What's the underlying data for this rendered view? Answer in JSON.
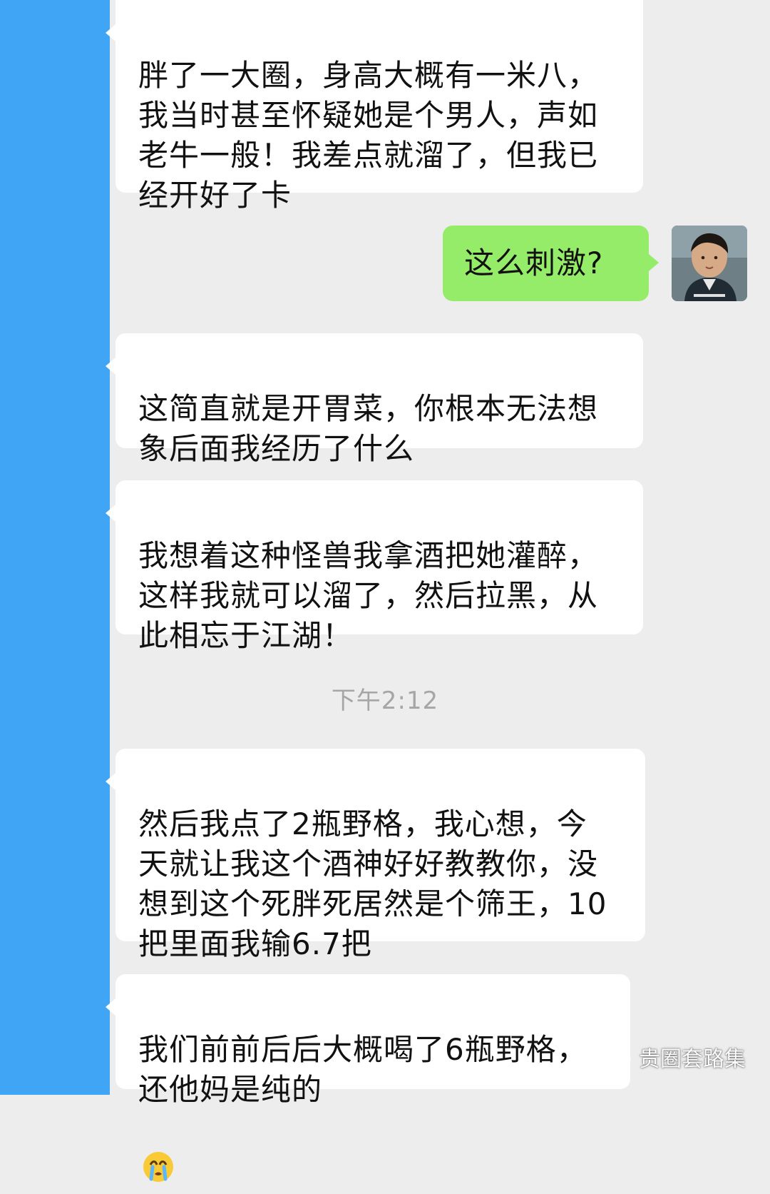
{
  "colors": {
    "left_strip": "#3fa5f4",
    "chat_background": "#ededed",
    "received_bubble": "#ffffff",
    "sent_bubble": "#95ec69",
    "timestamp_text": "#a6a6a6"
  },
  "messages": [
    {
      "side": "received",
      "text": "胖了一大圈，身高大概有一米八，\n我当时甚至怀疑她是个男人，声如\n老牛一般！我差点就溜了，但我已\n经开好了卡"
    },
    {
      "side": "sent",
      "text": "这么刺激?"
    },
    {
      "side": "received",
      "text": "这简直就是开胃菜，你根本无法想\n象后面我经历了什么"
    },
    {
      "side": "received",
      "text": "我想着这种怪兽我拿酒把她灌醉，\n这样我就可以溜了，然后拉黑，从\n此相忘于江湖！"
    },
    {
      "side": "received",
      "text": "然后我点了2瓶野格，我心想，今\n天就让我这个酒神好好教教你，没\n想到这个死胖死居然是个筛王，10\n把里面我输6.7把"
    },
    {
      "side": "received",
      "text": "我们前前后后大概喝了6瓶野格，\n还他妈是纯的",
      "emoji": "crying-face-icon"
    }
  ],
  "timestamp": "下午2:12",
  "watermark": {
    "icon": "wechat-icon",
    "text": "贵圈套路集"
  },
  "avatar": {
    "icon": "avatar-photo"
  }
}
